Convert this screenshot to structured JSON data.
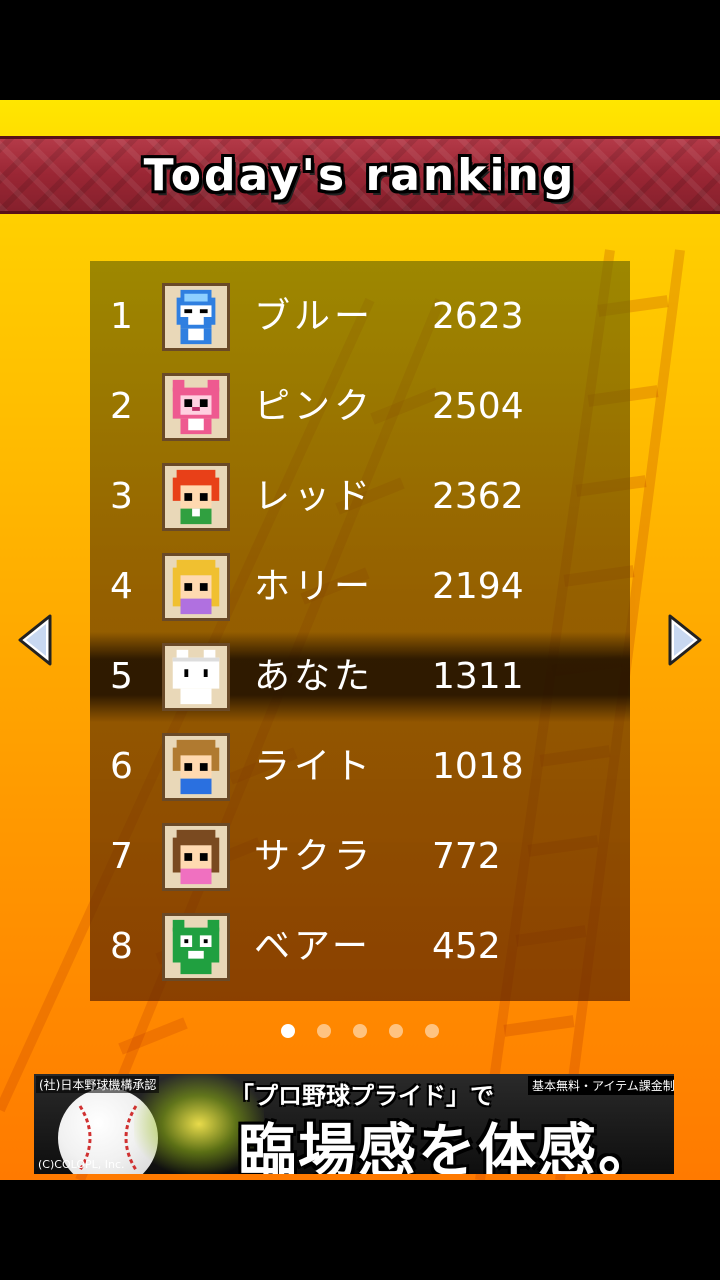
{
  "title": "Today's ranking",
  "rankings": [
    {
      "rank": "1",
      "name": "ブルー",
      "score": "2623",
      "avatar": "blue-helmet-character-icon"
    },
    {
      "rank": "2",
      "name": "ピンク",
      "score": "2504",
      "avatar": "pink-cat-character-icon"
    },
    {
      "rank": "3",
      "name": "レッド",
      "score": "2362",
      "avatar": "red-hair-boy-icon"
    },
    {
      "rank": "4",
      "name": "ホリー",
      "score": "2194",
      "avatar": "blonde-girl-icon"
    },
    {
      "rank": "5",
      "name": "あなた",
      "score": "1311",
      "avatar": "white-cat-character-icon",
      "highlighted": true
    },
    {
      "rank": "6",
      "name": "ライト",
      "score": "1018",
      "avatar": "brown-hair-boy-icon"
    },
    {
      "rank": "7",
      "name": "サクラ",
      "score": "772",
      "avatar": "brown-hair-girl-icon"
    },
    {
      "rank": "8",
      "name": "ベアー",
      "score": "452",
      "avatar": "green-bear-character-icon"
    }
  ],
  "pager": {
    "count": 5,
    "active": 0
  },
  "navigation": {
    "prev_icon": "left-arrow-icon",
    "next_icon": "right-arrow-icon"
  },
  "ad": {
    "association": "(社)日本野球機構承認",
    "tagline": "「プロ野球プライド」で",
    "free_note": "基本無料・アイテム課金制",
    "headline": "臨場感を体感。",
    "copyright": "(C)COLOPL, Inc."
  },
  "colors": {
    "background_top": "#ffe600",
    "background_bottom": "#ff7a00",
    "title_band": "#9a2634",
    "panel": "#6e4600"
  }
}
